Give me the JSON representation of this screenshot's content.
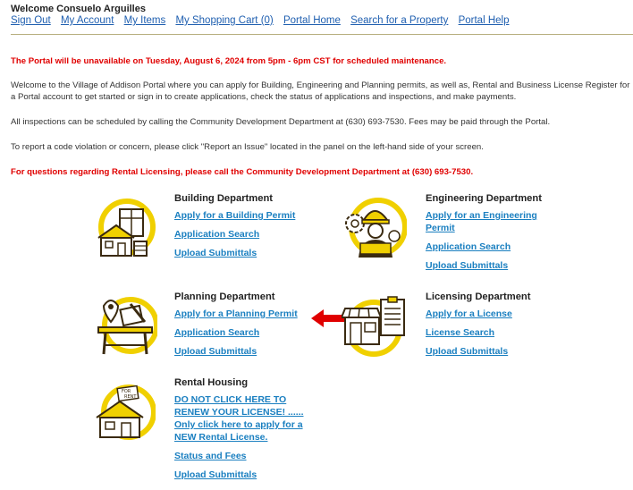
{
  "header": {
    "welcome": "Welcome Consuelo Arguilles",
    "nav": [
      "Sign Out",
      "My Account",
      "My Items",
      "My Shopping Cart (0)",
      "Portal Home",
      "Search for a Property",
      "Portal Help"
    ]
  },
  "notices": {
    "maintenance": "The Portal will be unavailable on Tuesday, August 6, 2024 from 5pm - 6pm CST for scheduled maintenance.",
    "intro": "Welcome to the Village of Addison Portal where you can apply for Building, Engineering and Planning permits, as well as, Rental and Business License Register for a Portal account to get started or sign in to create applications, check the status of applications and inspections, and make payments.",
    "inspections": "All inspections can be scheduled by calling the Community Development Department at (630) 693-7530. Fees may be paid through the Portal.",
    "violation": "To report a code violation or concern, please click \"Report an Issue\" located in the panel on the left-hand side of your screen.",
    "rental": "For questions regarding Rental Licensing, please call the Community Development Department at (630) 693-7530."
  },
  "departments": {
    "building": {
      "title": "Building Department",
      "links": [
        "Apply for a Building Permit",
        "Application Search",
        "Upload Submittals"
      ]
    },
    "engineering": {
      "title": "Engineering Department",
      "links": [
        "Apply for an Engineering Permit",
        "Application Search",
        "Upload Submittals"
      ]
    },
    "planning": {
      "title": "Planning Department",
      "links": [
        "Apply for a Planning Permit",
        "Application Search",
        "Upload Submittals"
      ]
    },
    "licensing": {
      "title": "Licensing Department",
      "links": [
        "Apply for a License",
        "License Search",
        "Upload Submittals"
      ]
    },
    "rental": {
      "title": "Rental Housing",
      "links": [
        "DO NOT CLICK HERE TO RENEW YOUR LICENSE! ......",
        "Only click here to apply for a NEW Rental License.",
        "Status and Fees",
        "Upload Submittals"
      ]
    }
  },
  "icons": {
    "building": "building-house-icon",
    "engineering": "engineer-icon",
    "planning": "planning-table-icon",
    "licensing": "license-storefront-icon",
    "rental": "for-rent-house-icon",
    "arrow": "red-arrow-icon"
  },
  "colors": {
    "accent_ring": "#f0d000",
    "link": "#1a7fc0",
    "alert": "#e00000",
    "nav_link": "#1f5fb0"
  }
}
